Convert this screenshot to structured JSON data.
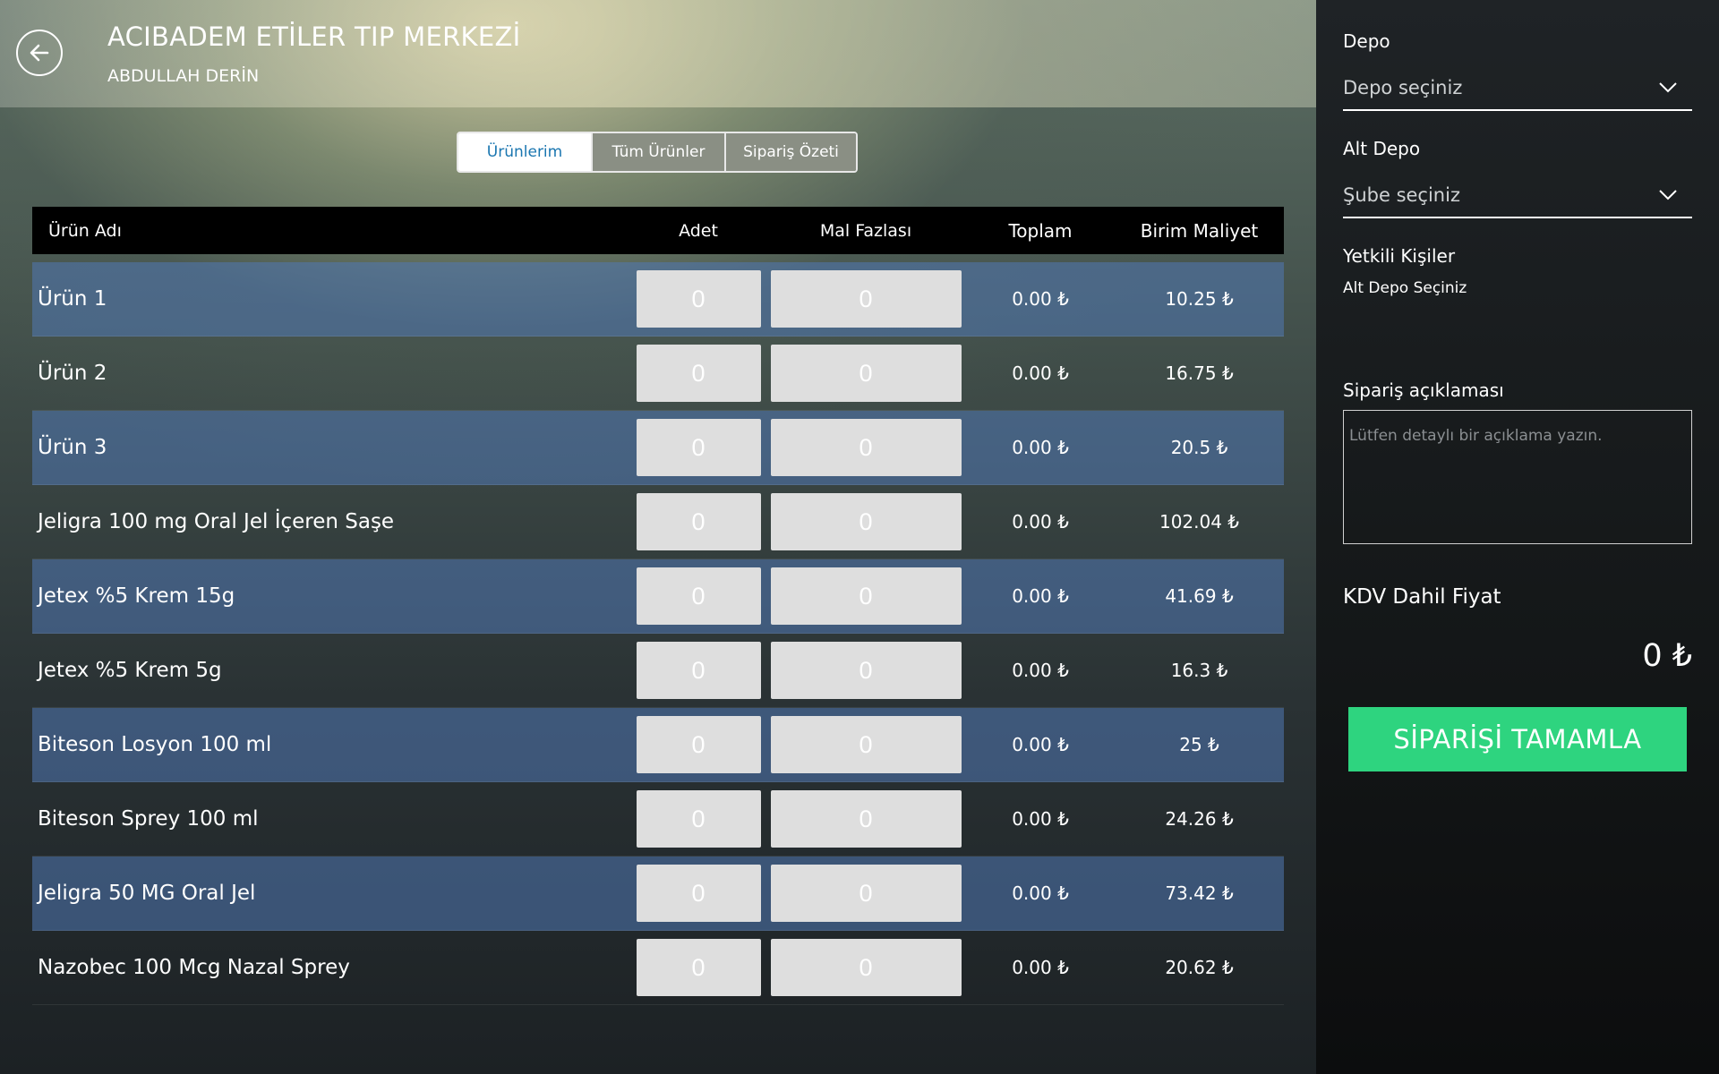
{
  "header": {
    "title": "ACIBADEM ETİLER TIP MERKEZİ",
    "subtitle": "ABDULLAH DERİN"
  },
  "tabs": [
    {
      "label": "Ürünlerim",
      "active": true
    },
    {
      "label": "Tüm Ürünler",
      "active": false
    },
    {
      "label": "Sipariş Özeti",
      "active": false
    }
  ],
  "table": {
    "columns": [
      "Ürün Adı",
      "Adet",
      "Mal Fazlası",
      "Toplam",
      "Birim Maliyet"
    ],
    "rows": [
      {
        "name": "Ürün 1",
        "adet": "0",
        "mal": "0",
        "toplam": "0.00 ₺",
        "birim": "10.25 ₺"
      },
      {
        "name": "Ürün 2",
        "adet": "0",
        "mal": "0",
        "toplam": "0.00 ₺",
        "birim": "16.75 ₺"
      },
      {
        "name": "Ürün 3",
        "adet": "0",
        "mal": "0",
        "toplam": "0.00 ₺",
        "birim": "20.5 ₺"
      },
      {
        "name": "Jeligra 100 mg Oral Jel İçeren Saşe",
        "adet": "0",
        "mal": "0",
        "toplam": "0.00 ₺",
        "birim": "102.04 ₺"
      },
      {
        "name": "Jetex %5 Krem 15g",
        "adet": "0",
        "mal": "0",
        "toplam": "0.00 ₺",
        "birim": "41.69 ₺"
      },
      {
        "name": "Jetex %5 Krem 5g",
        "adet": "0",
        "mal": "0",
        "toplam": "0.00 ₺",
        "birim": "16.3 ₺"
      },
      {
        "name": "Biteson Losyon 100 ml",
        "adet": "0",
        "mal": "0",
        "toplam": "0.00 ₺",
        "birim": "25 ₺"
      },
      {
        "name": "Biteson Sprey 100 ml",
        "adet": "0",
        "mal": "0",
        "toplam": "0.00 ₺",
        "birim": "24.26 ₺"
      },
      {
        "name": "Jeligra 50 MG Oral Jel",
        "adet": "0",
        "mal": "0",
        "toplam": "0.00 ₺",
        "birim": "73.42 ₺"
      },
      {
        "name": "Nazobec 100 Mcg Nazal Sprey",
        "adet": "0",
        "mal": "0",
        "toplam": "0.00 ₺",
        "birim": "20.62 ₺"
      }
    ]
  },
  "side": {
    "depo_label": "Depo",
    "depo_value": "Depo seçiniz",
    "altdepo_label": "Alt Depo",
    "altdepo_value": "Şube seçiniz",
    "contacts_label": "Yetkili Kişiler",
    "contacts_value": "Alt Depo Seçiniz",
    "desc_label": "Sipariş açıklaması",
    "desc_placeholder": "Lütfen detaylı bir açıklama yazın.",
    "kdv_label": "KDV Dahil Fiyat",
    "kdv_value": "0 ₺",
    "complete_label": "SİPARİŞİ TAMAMLA"
  },
  "colors": {
    "accent_green": "#2ed47f",
    "active_tab_text": "#1a76b0",
    "row_highlight": "#5078b4"
  },
  "icons": [
    "back-arrow-icon",
    "chevron-down-icon"
  ]
}
